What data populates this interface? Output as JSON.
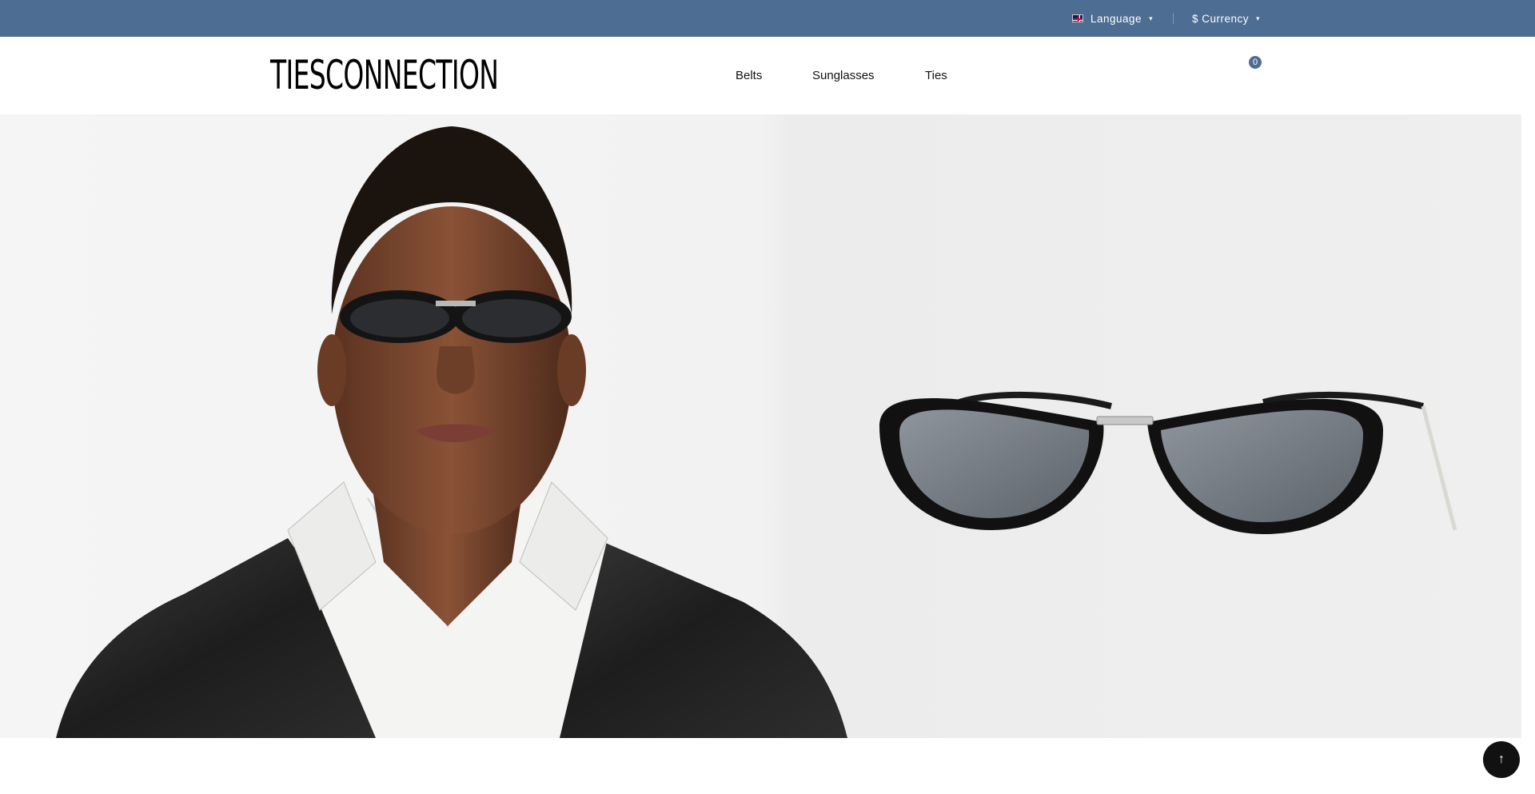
{
  "topbar": {
    "language_label": "Language",
    "currency_label": "$ Currency",
    "language_flag_icon": "uk-flag-icon",
    "caret_icon": "chevron-down-icon"
  },
  "header": {
    "logo_text": "TIESCONNECTION",
    "nav": [
      "Belts",
      "Sunglasses",
      "Ties"
    ],
    "cart_count": "0",
    "cart_icon": "cart-icon"
  },
  "hero": {
    "image": "model-wearing-black-oval-sunglasses-and-product-shot"
  },
  "back_to_top_icon": "arrow-up-icon",
  "colors": {
    "topbar_bg": "#4d6d93",
    "header_bg": "#ffffff",
    "text": "#111111",
    "badge_bg": "#4d6d93",
    "back_to_top_bg": "#111111"
  }
}
